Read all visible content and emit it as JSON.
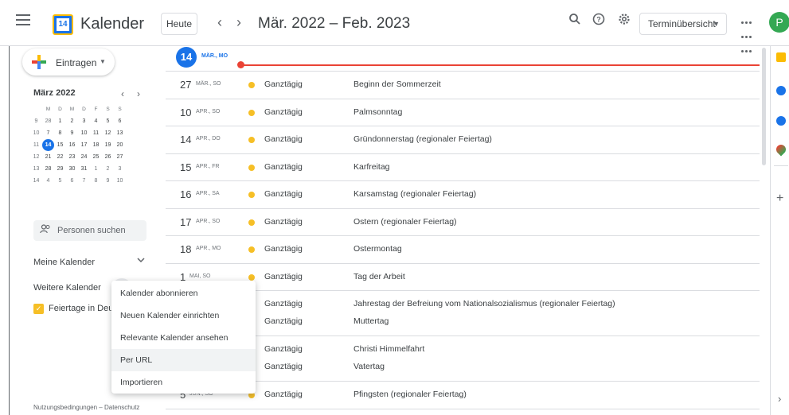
{
  "header": {
    "app_title": "Kalender",
    "logo_day": "14",
    "today_label": "Heute",
    "prev_icon": "‹",
    "next_icon": "›",
    "date_range": "Mär. 2022 – Feb. 2023",
    "view_label": "Terminübersicht",
    "avatar_initial": "P",
    "icons": [
      "search-icon",
      "help-icon",
      "settings-icon",
      "apps-icon"
    ]
  },
  "sidebar": {
    "create_label": "Eintragen",
    "mini_month": "März 2022",
    "weekday_headers": [
      "M",
      "D",
      "M",
      "D",
      "F",
      "S",
      "S"
    ],
    "weeks": [
      {
        "wk": "9",
        "days": [
          "28",
          "1",
          "2",
          "3",
          "4",
          "5",
          "6"
        ]
      },
      {
        "wk": "10",
        "days": [
          "7",
          "8",
          "9",
          "10",
          "11",
          "12",
          "13"
        ]
      },
      {
        "wk": "11",
        "days": [
          "14",
          "15",
          "16",
          "17",
          "18",
          "19",
          "20"
        ]
      },
      {
        "wk": "12",
        "days": [
          "21",
          "22",
          "23",
          "24",
          "25",
          "26",
          "27"
        ]
      },
      {
        "wk": "13",
        "days": [
          "28",
          "29",
          "30",
          "31",
          "1",
          "2",
          "3"
        ]
      },
      {
        "wk": "14",
        "days": [
          "4",
          "5",
          "6",
          "7",
          "8",
          "9",
          "10"
        ]
      }
    ],
    "people_placeholder": "Personen suchen",
    "my_calendars": "Meine Kalender",
    "other_calendars": "Weitere Kalender",
    "holiday_calendar": "Feiertage in Deutschland",
    "footer": "Nutzungsbedingungen – Datenschutz"
  },
  "menu": {
    "items": [
      "Kalender abonnieren",
      "Neuen Kalender einrichten",
      "Relevante Kalender ansehen",
      "Per URL",
      "Importieren"
    ]
  },
  "schedule": {
    "today_day": "14",
    "today_sub": "MÄR., MO",
    "rows": [
      {
        "day": "27",
        "sub": "MÄR., SO",
        "events": [
          {
            "time": "Ganztägig",
            "title": "Beginn der Sommerzeit"
          }
        ]
      },
      {
        "day": "10",
        "sub": "APR., SO",
        "events": [
          {
            "time": "Ganztägig",
            "title": "Palmsonntag"
          }
        ]
      },
      {
        "day": "14",
        "sub": "APR., DO",
        "events": [
          {
            "time": "Ganztägig",
            "title": "Gründonnerstag (regionaler Feiertag)"
          }
        ]
      },
      {
        "day": "15",
        "sub": "APR., FR",
        "events": [
          {
            "time": "Ganztägig",
            "title": "Karfreitag"
          }
        ]
      },
      {
        "day": "16",
        "sub": "APR., SA",
        "events": [
          {
            "time": "Ganztägig",
            "title": "Karsamstag (regionaler Feiertag)"
          }
        ]
      },
      {
        "day": "17",
        "sub": "APR., SO",
        "events": [
          {
            "time": "Ganztägig",
            "title": "Ostern (regionaler Feiertag)"
          }
        ]
      },
      {
        "day": "18",
        "sub": "APR., MO",
        "events": [
          {
            "time": "Ganztägig",
            "title": "Ostermontag"
          }
        ]
      },
      {
        "day": "1",
        "sub": "MAI, SO",
        "events": [
          {
            "time": "Ganztägig",
            "title": "Tag der Arbeit"
          }
        ]
      },
      {
        "day": "",
        "sub": "",
        "events": [
          {
            "time": "Ganztägig",
            "title": "Jahrestag der Befreiung vom Nationalsozialismus (regionaler Feiertag)"
          },
          {
            "time": "Ganztägig",
            "title": "Muttertag"
          }
        ]
      },
      {
        "day": "",
        "sub": "",
        "events": [
          {
            "time": "Ganztägig",
            "title": "Christi Himmelfahrt"
          },
          {
            "time": "Ganztägig",
            "title": "Vatertag"
          }
        ]
      },
      {
        "day": "5",
        "sub": "JUN., SO",
        "events": [
          {
            "time": "Ganztägig",
            "title": "Pfingsten (regionaler Feiertag)"
          }
        ]
      }
    ]
  },
  "colors": {
    "accent": "#1a73e8",
    "holiday": "#f6bf26",
    "now": "#ea4335",
    "avatar": "#34a853"
  }
}
